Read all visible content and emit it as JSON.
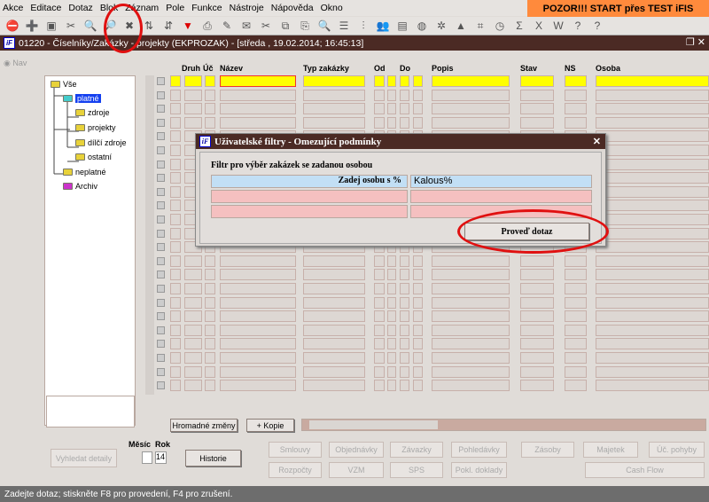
{
  "menu": [
    "Akce",
    "Editace",
    "Dotaz",
    "Blok",
    "Záznam",
    "Pole",
    "Funkce",
    "Nástroje",
    "Nápověda",
    "Okno"
  ],
  "banner": "POZOR!!!  START přes TEST iFIS",
  "toolbar_icons": [
    "exit-icon",
    "insert-record-icon",
    "delete-record-icon",
    "clear-icon",
    "query-enter-icon",
    "query-execute-icon",
    "query-cancel-icon",
    "sort-asc-icon",
    "sort-desc-icon",
    "filter-icon",
    "print-icon",
    "edit-icon",
    "mail-icon",
    "cut-icon",
    "copy-icon",
    "paste-icon",
    "search-icon",
    "list-icon",
    "tree-icon",
    "users-icon",
    "doc-icon",
    "globe-icon",
    "gear-icon",
    "up-icon",
    "chart-icon",
    "clock-icon",
    "sum-icon",
    "excel-icon",
    "word-icon",
    "help-coins-icon",
    "help-icon"
  ],
  "window": {
    "title": "01220 - Číselníky/Zakázky - projekty (EKPROZAK) - [středa , 19.02.2014; 16:45:13]",
    "logo": "iF"
  },
  "nav_label": "Nav",
  "tree": [
    {
      "label": "Vše"
    },
    {
      "label": "platné"
    },
    {
      "label": "zdroje"
    },
    {
      "label": "projekty"
    },
    {
      "label": "dílčí zdroje"
    },
    {
      "label": "ostatní"
    },
    {
      "label": "neplatné"
    },
    {
      "label": "Archiv"
    }
  ],
  "columns": {
    "druh": "Druh",
    "uc": "Úč",
    "nazev": "Název",
    "typ": "Typ zakázky",
    "od": "Od",
    "do": "Do",
    "popis": "Popis",
    "stav": "Stav",
    "ns": "NS",
    "osoba": "Osoba"
  },
  "dialog": {
    "title": "Uživatelské filtry -  Omezující podmínky",
    "heading": "Filtr pro výběr zakázek se zadanou osobou",
    "field_label": "Zadej osobu s %",
    "field_value": "Kalous%",
    "submit": "Proveď dotaz",
    "close": "✕"
  },
  "buttons": {
    "hromadne": "Hromadné změny",
    "kopie": "+ Kopie",
    "vyhledat": "Vyhledat detaily",
    "historie": "Historie"
  },
  "period": {
    "mesic_label": "Měsíc",
    "rok_label": "Rok",
    "mesic": "",
    "rok": "14"
  },
  "module_buttons": [
    "Smlouvy",
    "Objednávky",
    "Závazky",
    "Pohledávky",
    "Zásoby",
    "Majetek",
    "Úč. pohyby",
    "Rozpočty",
    "VZM",
    "SPS",
    "Pokl. doklady",
    "Cash Flow"
  ],
  "status": "Zadejte dotaz; stiskněte F8 pro provedení, F4 pro zrušení."
}
